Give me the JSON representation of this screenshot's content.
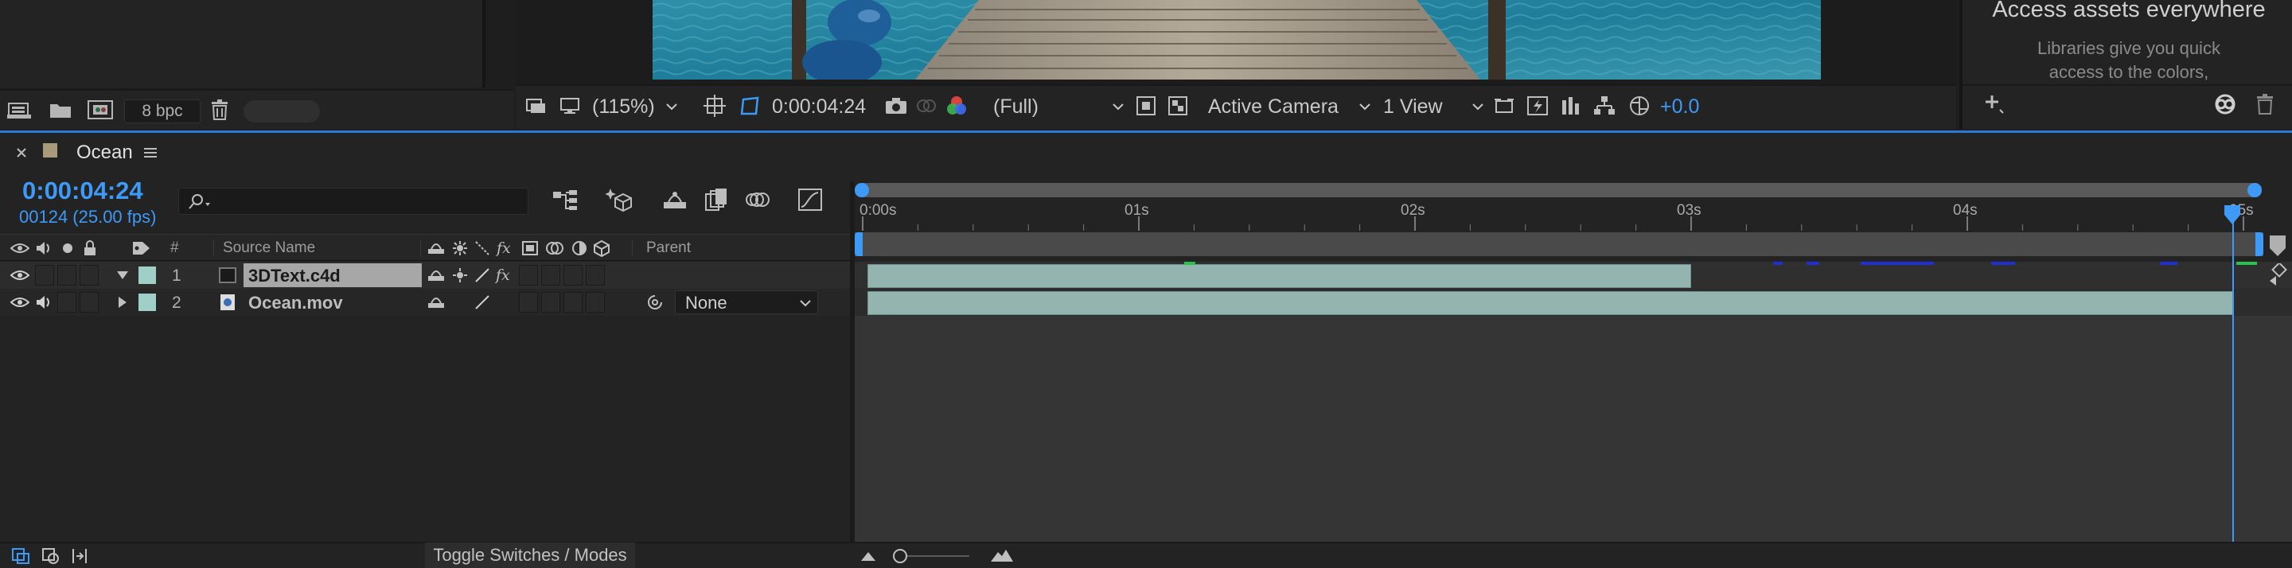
{
  "project_panel": {
    "bit_depth": "8 bpc",
    "icons": [
      "interpret-footage-icon",
      "new-folder-icon",
      "new-composition-icon",
      "trash-icon"
    ]
  },
  "viewer": {
    "zoom": "(115%)",
    "timecode": "0:00:04:24",
    "resolution": "(Full)",
    "camera": "Active Camera",
    "views": "1 View",
    "exposure": "+0.0"
  },
  "libraries": {
    "title": "Access assets everywhere",
    "text_line1": "Libraries give you quick",
    "text_line2": "access to the colors,"
  },
  "timeline": {
    "tab": {
      "title": "Ocean",
      "label_color": "#a99a7c"
    },
    "current_time": "0:00:04:24",
    "frame_info": "00124 (25.00 fps)",
    "search_placeholder": "",
    "headers": {
      "number": "#",
      "source_name": "Source Name",
      "parent": "Parent"
    },
    "ruler": {
      "ticks": [
        "0:00s",
        "01s",
        "02s",
        "03s",
        "04s",
        "05s"
      ]
    },
    "layers": [
      {
        "number": "1",
        "name": "3DText.c4d",
        "label_color": "#9fcfc6",
        "expanded": true,
        "end_time": "3.0s"
      },
      {
        "number": "2",
        "name": "Ocean.mov",
        "label_color": "#9fcfc6",
        "expanded": false,
        "parent": "None",
        "end_time": "5.0s"
      }
    ],
    "playhead_seconds": 4.96,
    "bottom": {
      "toggle_label": "Toggle Switches / Modes"
    }
  },
  "colors": {
    "accent": "#3d9af7",
    "bar_fill": "#93b4af",
    "panel_bg": "#232323"
  }
}
